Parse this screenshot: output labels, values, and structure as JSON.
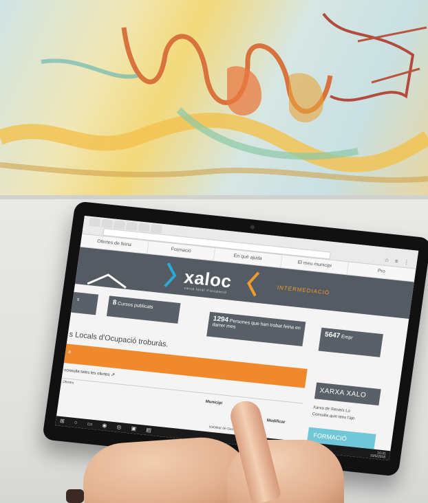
{
  "browser": {
    "tabs": [
      "",
      "",
      "",
      "",
      "",
      ""
    ],
    "icons": "☆ ≡ ⋮"
  },
  "site": {
    "nav": [
      "Ofertes de feina",
      "Formació",
      "En què ajuda",
      "El meu municipi",
      "Pro"
    ],
    "logo": "xaloc",
    "logo_sub": "xarxa local d'ocupació",
    "section_label": "INTERMEDIACIÓ",
    "stats": [
      {
        "value": "",
        "label": "s"
      },
      {
        "value": "8",
        "label": "Cursos publicats"
      },
      {
        "value": "1294",
        "label": "Persones que han trobat feina en darrer mes"
      },
      {
        "value": "5647",
        "label": "Empr"
      }
    ],
    "heading": "s Locals d'Ocupació troburàs.",
    "orange_label": "a",
    "offers_link": "consulta totes les ofertes",
    "table_columns": [
      "Ofertes"
    ],
    "municipi": "Municipi",
    "modificar": "Modificar",
    "detall": "Habilitat de Gestió",
    "sidebar": {
      "xarxa": "XARXA XALO",
      "text_line1": "Xarxa de Serveis Lo",
      "text_line2": "Consulta quin tens l'ajo",
      "formacio": "FORMACIÓ"
    }
  },
  "taskbar": {
    "icons": "⊞ ○ ▭ ◉ ◎ ▣ ▤",
    "time": "16:31",
    "date": "10/5/2018"
  },
  "colors": {
    "banner": "#555b63",
    "orange": "#f0892b",
    "accent_blue": "#2aa9d6",
    "accent_orange": "#f39a2c",
    "formacio": "#6fc7d8"
  }
}
